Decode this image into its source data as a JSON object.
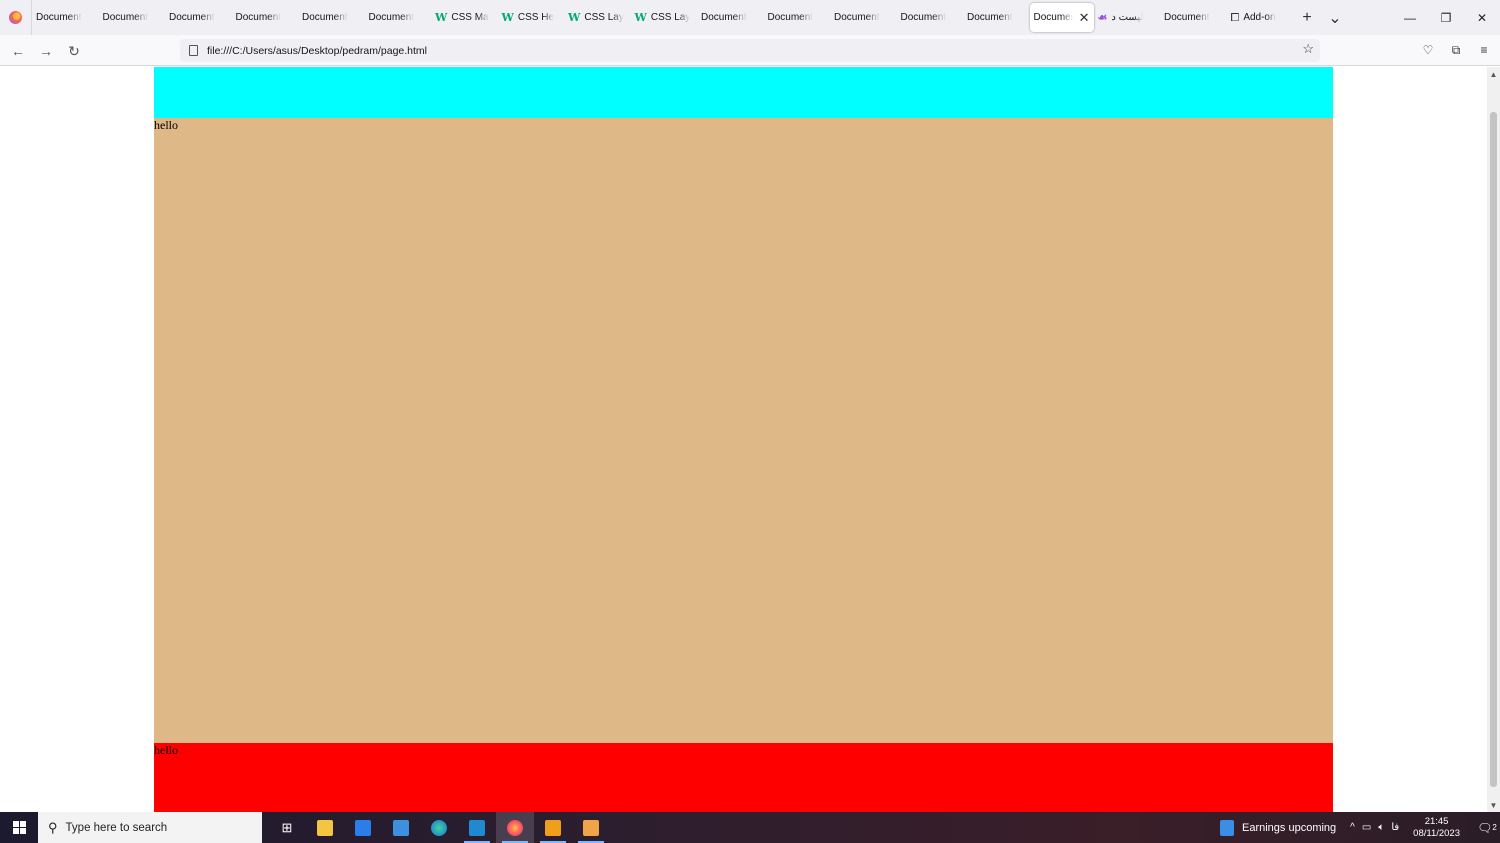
{
  "browser": {
    "tabs": [
      {
        "label": "Document",
        "favicon": "",
        "active": false
      },
      {
        "label": "Document",
        "favicon": "",
        "active": false
      },
      {
        "label": "Document",
        "favicon": "",
        "active": false
      },
      {
        "label": "Document",
        "favicon": "",
        "active": false
      },
      {
        "label": "Document",
        "favicon": "",
        "active": false
      },
      {
        "label": "Document",
        "favicon": "",
        "active": false
      },
      {
        "label": "CSS Ma",
        "favicon": "w3schools",
        "active": false
      },
      {
        "label": "CSS He",
        "favicon": "w3schools",
        "active": false
      },
      {
        "label": "CSS Lay",
        "favicon": "w3schools",
        "active": false
      },
      {
        "label": "CSS Lay",
        "favicon": "w3schools",
        "active": false
      },
      {
        "label": "Document",
        "favicon": "",
        "active": false
      },
      {
        "label": "Document",
        "favicon": "",
        "active": false
      },
      {
        "label": "Document",
        "favicon": "",
        "active": false
      },
      {
        "label": "Document",
        "favicon": "",
        "active": false
      },
      {
        "label": "Document",
        "favicon": "",
        "active": false
      },
      {
        "label": "Documen",
        "favicon": "",
        "active": true
      },
      {
        "label": "لیست د",
        "favicon": "purple",
        "active": false
      },
      {
        "label": "Document",
        "favicon": "",
        "active": false
      },
      {
        "label": "Add-on",
        "favicon": "puzzle",
        "active": false
      }
    ],
    "url": "file:///C:/Users/asus/Desktop/pedram/page.html"
  },
  "page": {
    "main_text": "hello",
    "footer_text": "hello",
    "colors": {
      "header": "#00ffff",
      "main": "#deb887",
      "footer": "#ff0000"
    }
  },
  "taskbar": {
    "search_placeholder": "Type here to search",
    "news": "Earnings upcoming",
    "time": "21:45",
    "date": "08/11/2023",
    "lang": "فا",
    "notification_count": "2"
  }
}
